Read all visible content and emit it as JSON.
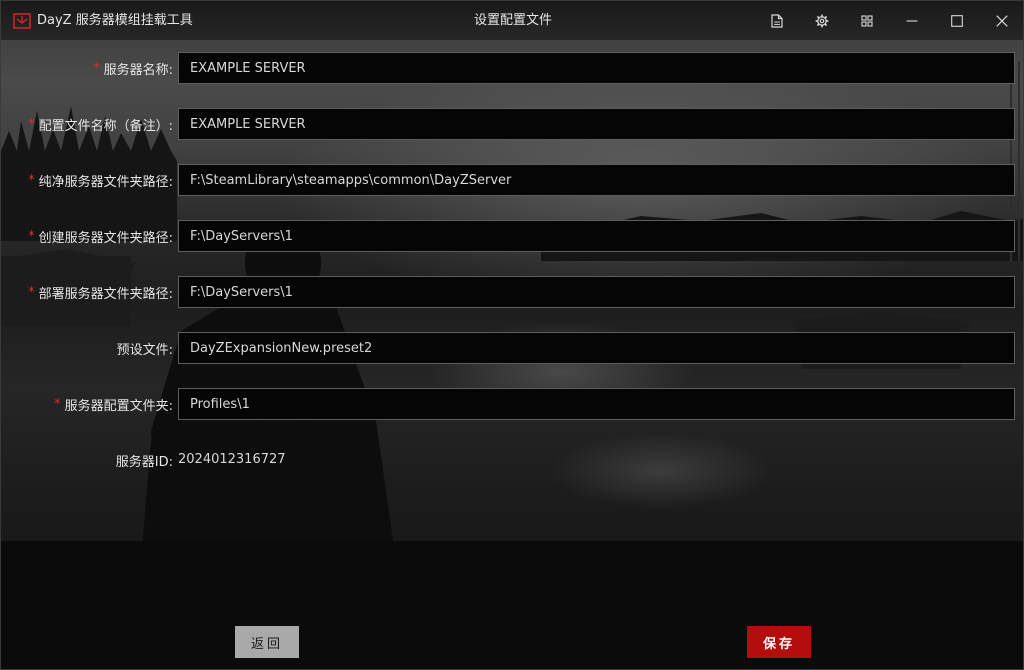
{
  "window": {
    "app_title": "DayZ 服务器模组挂载工具",
    "page_title": "设置配置文件",
    "accent_color": "#b30e0e",
    "titlebar_icons": [
      "document-icon",
      "gear-icon",
      "grid-icon",
      "minimize-icon",
      "maximize-icon",
      "close-icon"
    ]
  },
  "form": {
    "server_name": {
      "label": "服务器名称:",
      "required": "*",
      "value": "EXAMPLE SERVER"
    },
    "config_name": {
      "label": "配置文件名称（备注）:",
      "required": "*",
      "value": "EXAMPLE SERVER"
    },
    "vanilla_path": {
      "label": "纯净服务器文件夹路径:",
      "required": "*",
      "value": "F:\\SteamLibrary\\steamapps\\common\\DayZServer"
    },
    "create_path": {
      "label": "创建服务器文件夹路径:",
      "required": "*",
      "value": "F:\\DayServers\\1"
    },
    "deploy_path": {
      "label": "部署服务器文件夹路径:",
      "required": "*",
      "value": "F:\\DayServers\\1"
    },
    "preset_file": {
      "label": "预设文件:",
      "value": "DayZExpansionNew.preset2"
    },
    "profiles_folder": {
      "label": "服务器配置文件夹:",
      "required": "*",
      "value": "Profiles\\1"
    },
    "server_id": {
      "label": "服务器ID:",
      "value": "2024012316727"
    }
  },
  "buttons": {
    "back": "返回",
    "save": "保存"
  }
}
